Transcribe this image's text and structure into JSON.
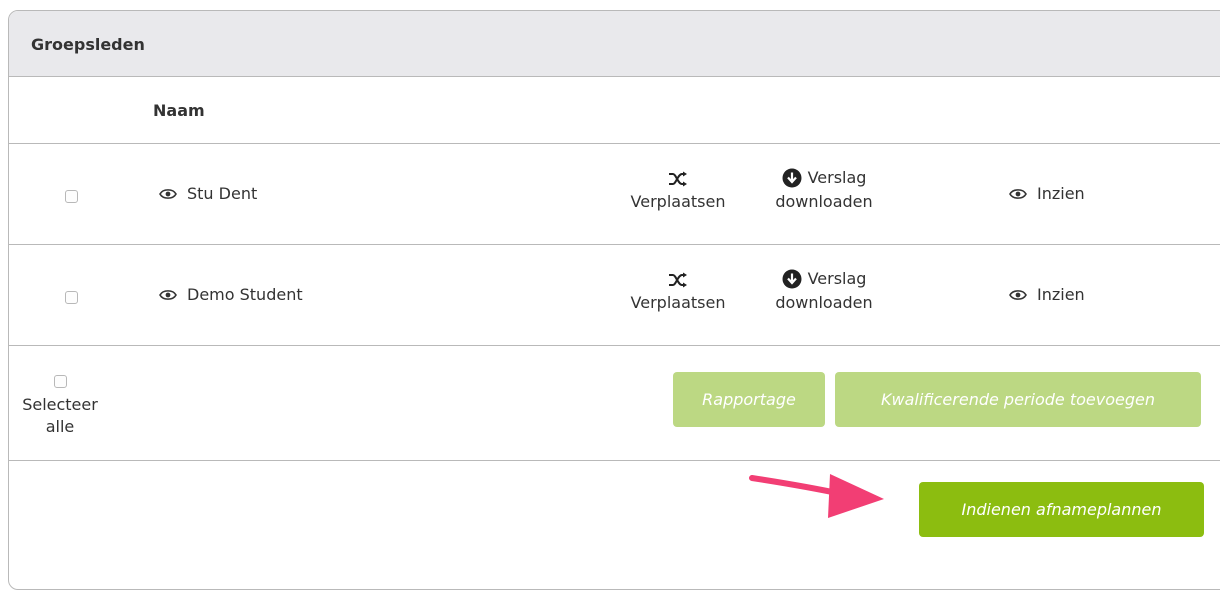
{
  "panel": {
    "title": "Groepsleden"
  },
  "table": {
    "name_header": "Naam",
    "rows": [
      {
        "name": "Stu Dent",
        "move_label": "Verplaatsen",
        "report_label_1": "Verslag",
        "report_label_2": "downloaden",
        "view_label": "Inzien"
      },
      {
        "name": "Demo Student",
        "move_label": "Verplaatsen",
        "report_label_1": "Verslag",
        "report_label_2": "downloaden",
        "view_label": "Inzien"
      }
    ]
  },
  "footer": {
    "select_all_line1": "Selecteer",
    "select_all_line2": "alle",
    "rapportage_label": "Rapportage",
    "kwalificerend_label": "Kwalificerende periode toevoegen",
    "submit_label": "Indienen afnameplannen"
  },
  "icons": {
    "eye": "eye-icon",
    "shuffle": "shuffle-icon",
    "download": "download-circle-icon",
    "arrow": "pointer-arrow-icon"
  },
  "colors": {
    "header_bg": "#e9e9ec",
    "button_light": "#bcd883",
    "button_primary": "#8cbd10",
    "arrow": "#f23e74"
  }
}
